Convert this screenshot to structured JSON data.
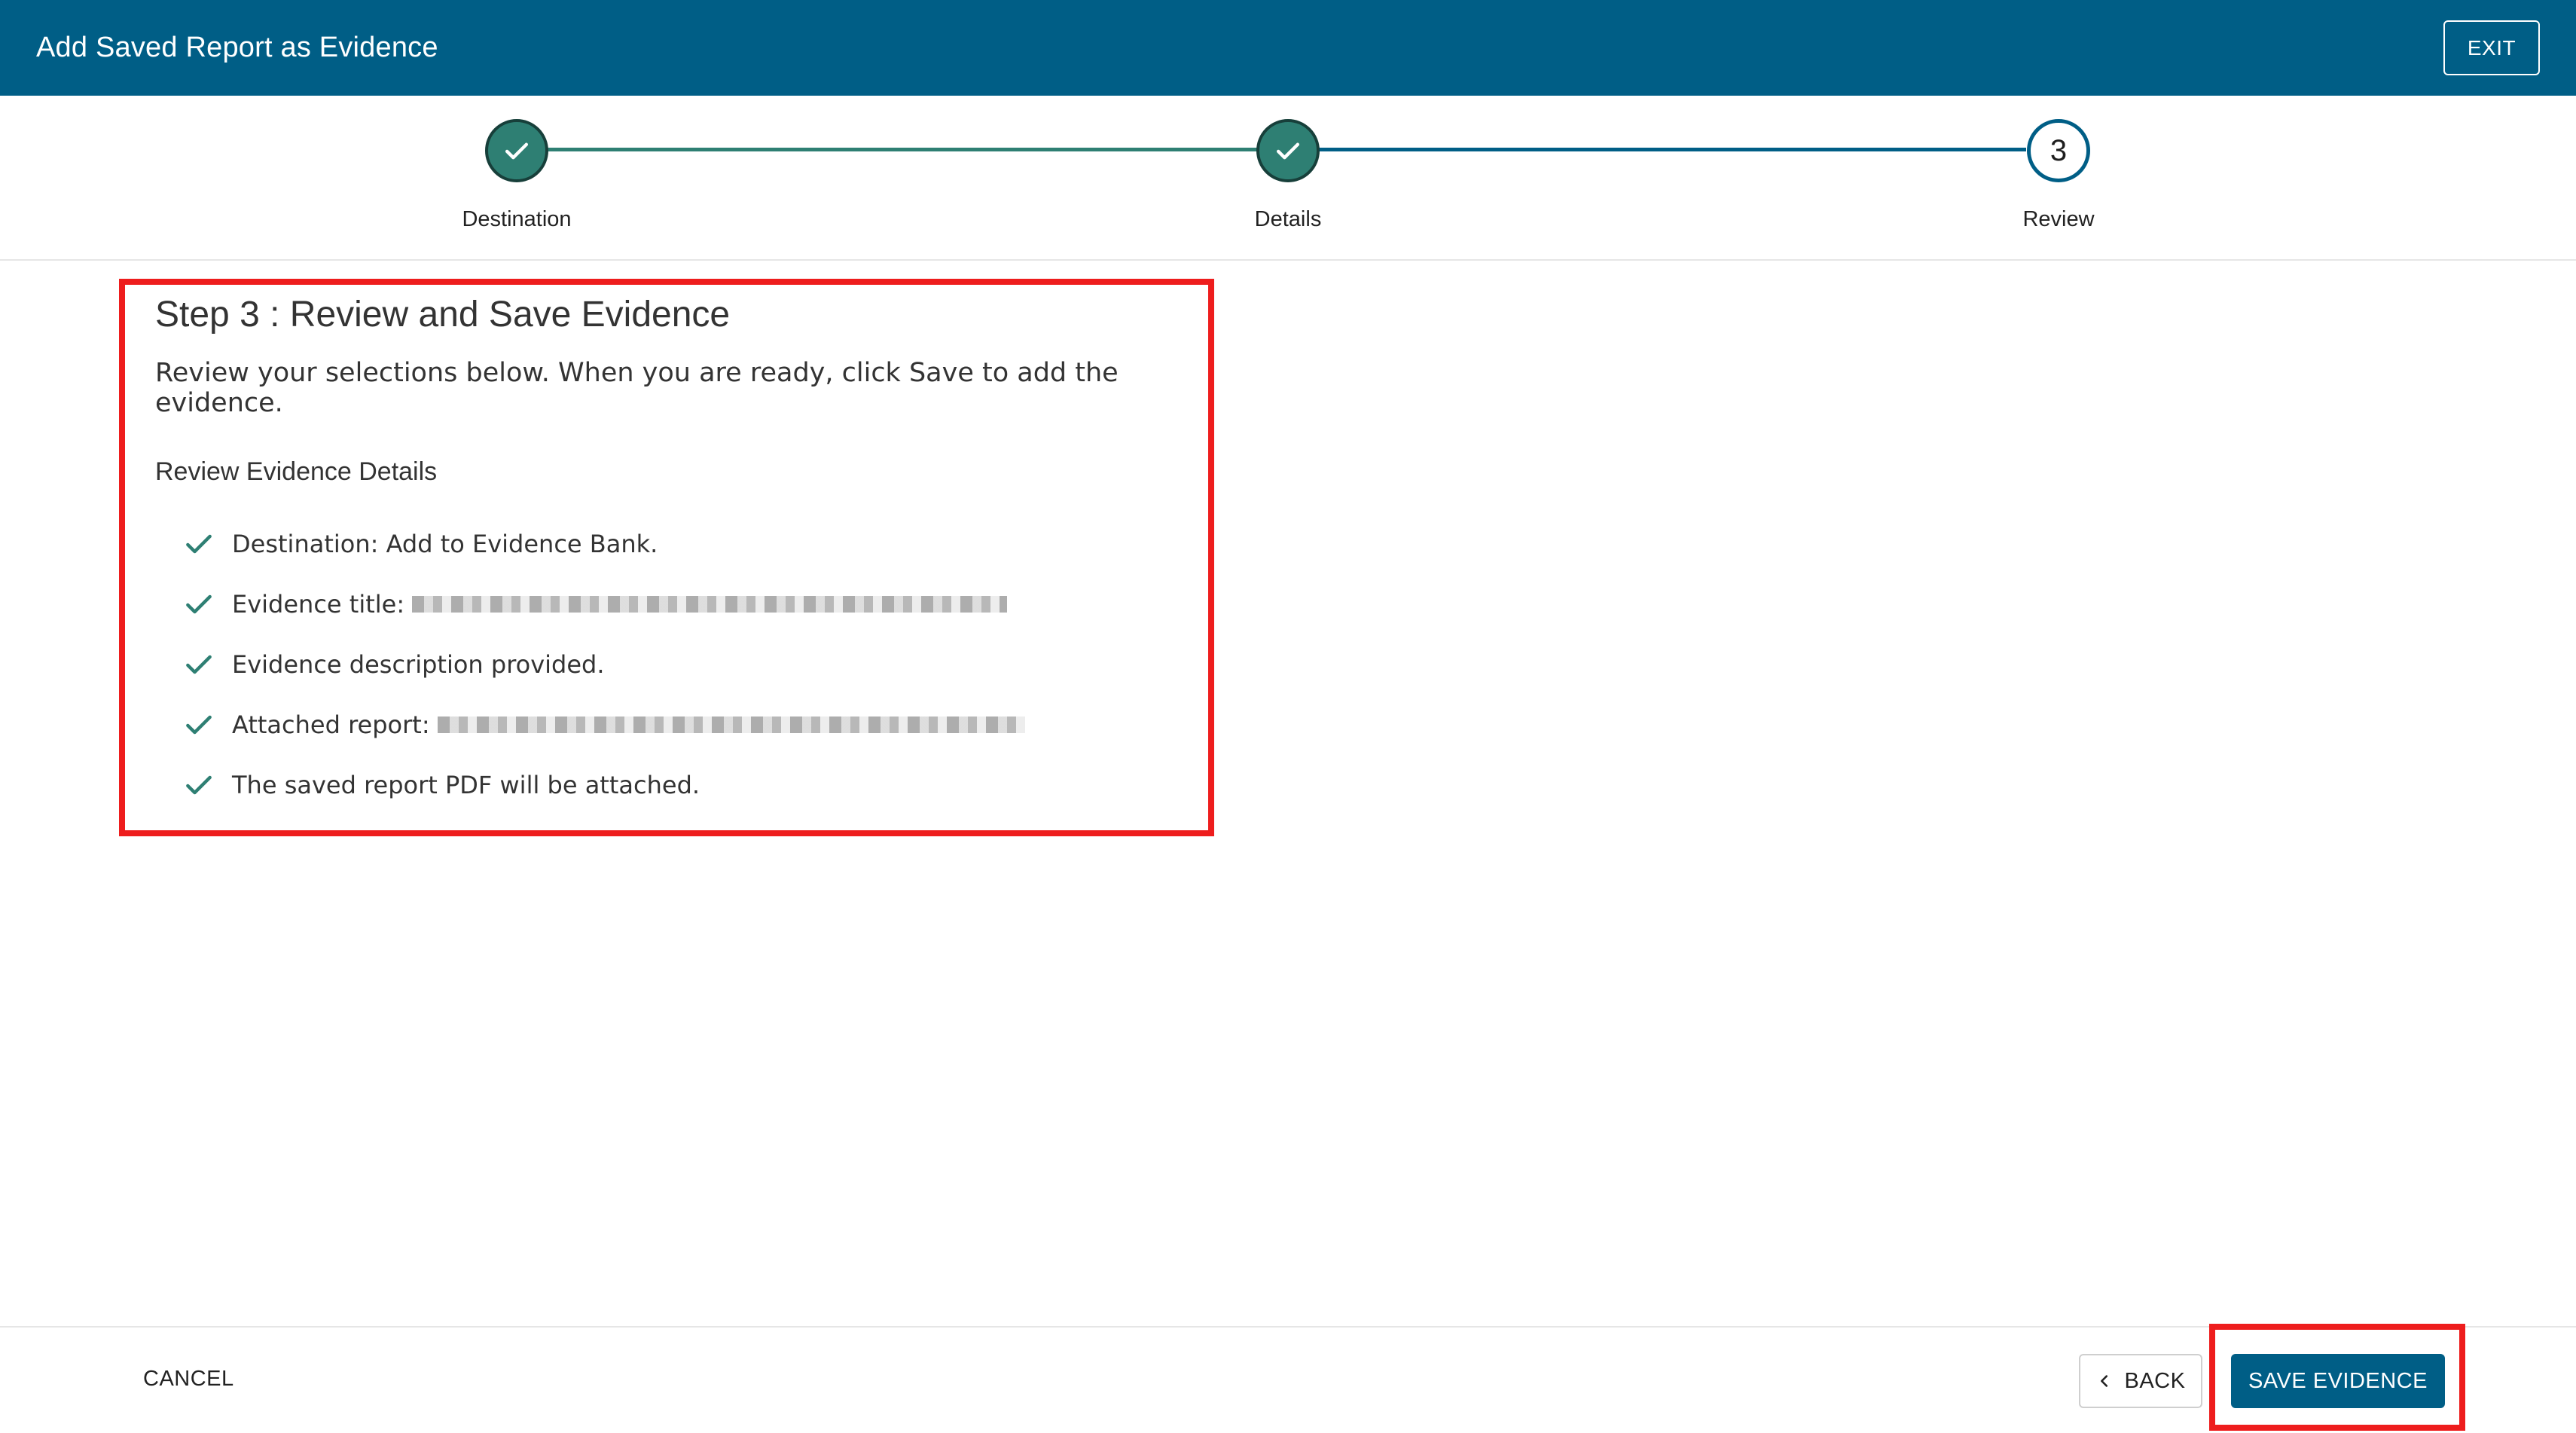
{
  "header": {
    "title": "Add Saved Report as Evidence",
    "exit_label": "EXIT"
  },
  "stepper": {
    "steps": [
      {
        "label": "Destination",
        "state": "complete"
      },
      {
        "label": "Details",
        "state": "complete"
      },
      {
        "label": "Review",
        "state": "active",
        "number": "3"
      }
    ]
  },
  "review": {
    "heading": "Step 3 : Review and Save Evidence",
    "description": "Review your selections below. When you are ready, click Save to add the evidence.",
    "section_title": "Review Evidence Details",
    "items": [
      {
        "text": "Destination: Add to Evidence Bank."
      },
      {
        "text": "Evidence title:"
      },
      {
        "text": "Evidence description provided."
      },
      {
        "text": "Attached report:"
      },
      {
        "text": "The saved report PDF will be attached."
      }
    ]
  },
  "footer": {
    "cancel_label": "CANCEL",
    "back_label": "BACK",
    "save_label": "SAVE EVIDENCE"
  },
  "colors": {
    "header_bg": "#005e86",
    "complete_green": "#2e7f73",
    "highlight_red": "#ee1d1d"
  }
}
